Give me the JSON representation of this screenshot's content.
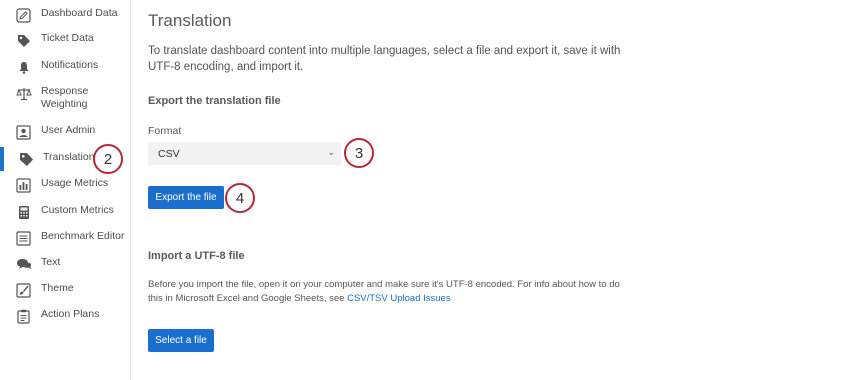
{
  "sidebar": {
    "items": [
      {
        "label": "Dashboard Data",
        "icon": "pencil-icon"
      },
      {
        "label": "Ticket Data",
        "icon": "tag-icon"
      },
      {
        "label": "Notifications",
        "icon": "bell-icon"
      },
      {
        "label": "Response Weighting",
        "icon": "scale-icon"
      },
      {
        "label": "User Admin",
        "icon": "user-admin-icon"
      },
      {
        "label": "Translation",
        "icon": "translation-tag-icon"
      },
      {
        "label": "Usage Metrics",
        "icon": "bar-chart-icon"
      },
      {
        "label": "Custom Metrics",
        "icon": "calculator-icon"
      },
      {
        "label": "Benchmark Editor",
        "icon": "list-icon"
      },
      {
        "label": "Text",
        "icon": "chat-bubbles-icon"
      },
      {
        "label": "Theme",
        "icon": "paint-brush-icon"
      },
      {
        "label": "Action Plans",
        "icon": "clipboard-icon"
      }
    ]
  },
  "main": {
    "title": "Translation",
    "intro": "To translate dashboard content into multiple languages, select a file and export it, save it with UTF-8 encoding, and import it.",
    "export_heading": "Export the translation file",
    "format_label": "Format",
    "format_value": "CSV",
    "export_button": "Export the file",
    "import_heading": "Import a UTF-8 file",
    "import_text": "Before you import the file, open it on your computer and make sure it's UTF-8 encoded. For info about how to do this in Microsoft Excel and Google Sheets, see ",
    "import_link": "CSV/TSV Upload Issues",
    "select_button": "Select a file"
  },
  "callouts": {
    "translation": "2",
    "format": "3",
    "export": "4"
  },
  "colors": {
    "accent": "#1a6fce",
    "active_bar": "#1a74c7",
    "callout_border": "#b4293a"
  }
}
